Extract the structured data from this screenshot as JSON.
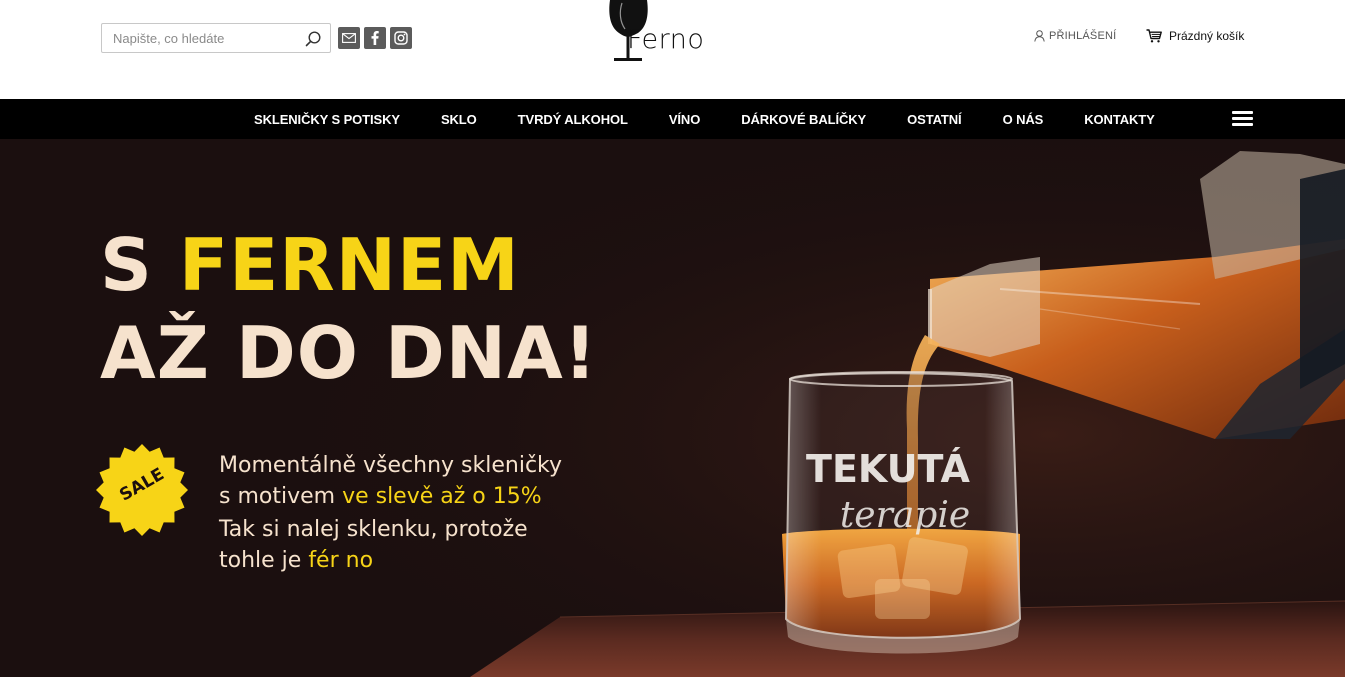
{
  "header": {
    "search": {
      "placeholder": "Napište, co hledáte"
    },
    "socials": [
      {
        "icon": "mail-icon"
      },
      {
        "icon": "facebook-icon"
      },
      {
        "icon": "instagram-icon"
      }
    ],
    "logo_text": "Ferno",
    "login_label": "PŘIHLÁŠENÍ",
    "cart_label": "Prázdný košík"
  },
  "nav": {
    "items": [
      {
        "label": "SKLENIČKY S POTISKY"
      },
      {
        "label": "SKLO"
      },
      {
        "label": "TVRDÝ ALKOHOL"
      },
      {
        "label": "VÍNO"
      },
      {
        "label": "DÁRKOVÉ BALÍČKY"
      },
      {
        "label": "OSTATNÍ"
      },
      {
        "label": "O NÁS"
      },
      {
        "label": "KONTAKTY"
      }
    ]
  },
  "hero": {
    "line1_prefix": "S ",
    "line1_highlight": "FERNEM",
    "line2": "AŽ DO DNA!",
    "sale_label": "SALE",
    "promo_line1": "Momentálně všechny skleničky",
    "promo_line2_prefix": "s motivem ",
    "promo_line2_highlight": "ve slevě až o 15%",
    "promo_line3": "Tak si nalej sklenku, protože",
    "promo_line4_prefix": "tohle je ",
    "promo_line4_highlight": "fér no",
    "glass_text_top": "TEKUTÁ",
    "glass_text_bottom": "terapie"
  },
  "colors": {
    "accent_yellow": "#f7d417",
    "cream": "#f6e2cd",
    "hero_bg": "#1b0f0f",
    "nav_bg": "#000000",
    "icon_grey": "#5b5b5b"
  }
}
